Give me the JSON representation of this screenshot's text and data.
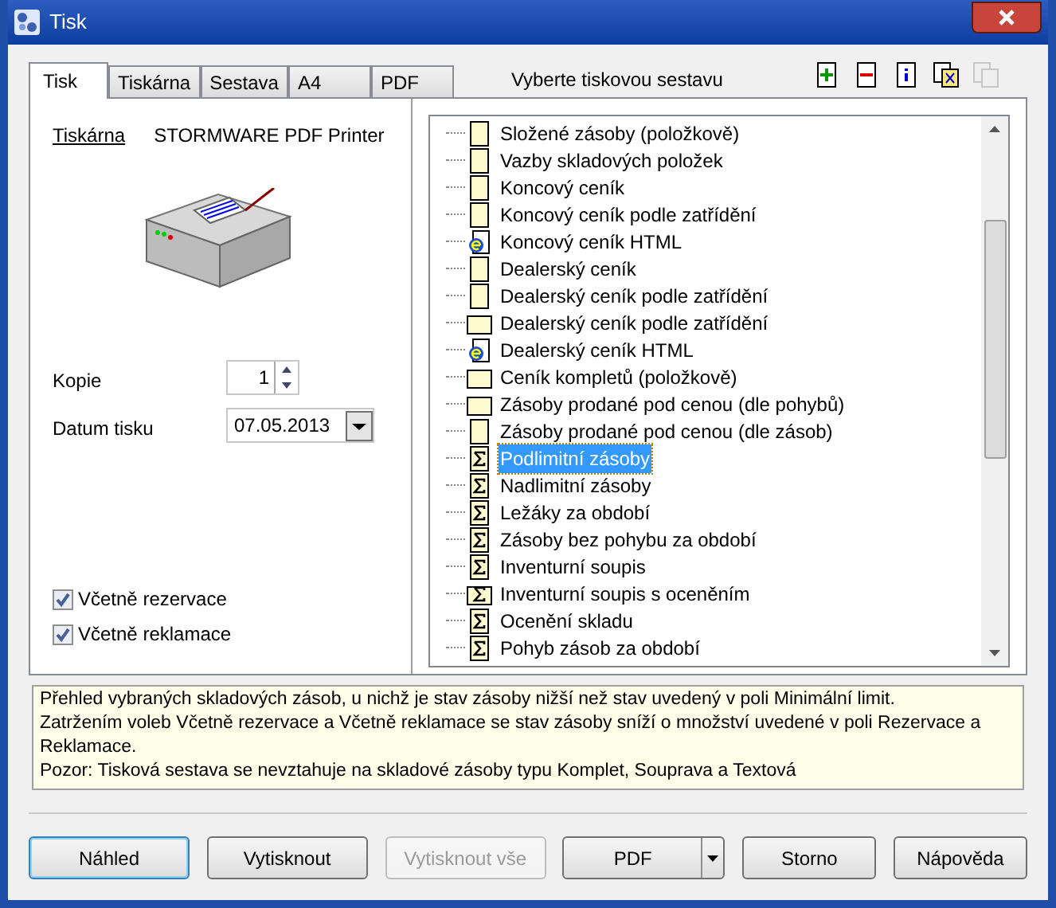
{
  "window": {
    "title": "Tisk"
  },
  "tabs": [
    {
      "label": "Tisk",
      "selected": true
    },
    {
      "label": "Tiskárna",
      "selected": false
    },
    {
      "label": "Sestava",
      "selected": false
    },
    {
      "label": "A4",
      "selected": false
    },
    {
      "label": "PDF",
      "selected": false
    }
  ],
  "report_heading": "Vyberte tiskovou sestavu",
  "printer": {
    "label": "Tiskárna",
    "name": "STORMWARE PDF Printer"
  },
  "copies": {
    "label": "Kopie",
    "value": "1"
  },
  "print_date": {
    "label": "Datum tisku",
    "value": "07.05.2013"
  },
  "options": [
    {
      "label": "Včetně rezervace",
      "checked": true
    },
    {
      "label": "Včetně reklamace",
      "checked": true
    }
  ],
  "reports": [
    {
      "label": "Složené zásoby (položkově)",
      "kind": "page",
      "selected": false
    },
    {
      "label": "Vazby skladových položek",
      "kind": "page",
      "selected": false
    },
    {
      "label": "Koncový ceník",
      "kind": "page",
      "selected": false
    },
    {
      "label": "Koncový ceník podle zatřídění",
      "kind": "page",
      "selected": false
    },
    {
      "label": "Koncový ceník HTML",
      "kind": "web",
      "selected": false
    },
    {
      "label": "Dealerský ceník",
      "kind": "page",
      "selected": false
    },
    {
      "label": "Dealerský ceník podle zatřídění",
      "kind": "page",
      "selected": false
    },
    {
      "label": "Dealerský ceník podle zatřídění",
      "kind": "wide",
      "selected": false
    },
    {
      "label": "Dealerský ceník HTML",
      "kind": "web",
      "selected": false
    },
    {
      "label": "Ceník kompletů (položkově)",
      "kind": "wide",
      "selected": false
    },
    {
      "label": "Zásoby prodané pod cenou (dle pohybů)",
      "kind": "wide",
      "selected": false
    },
    {
      "label": "Zásoby prodané pod cenou (dle zásob)",
      "kind": "page",
      "selected": false
    },
    {
      "label": "Podlimitní zásoby",
      "kind": "sum",
      "selected": true
    },
    {
      "label": "Nadlimitní zásoby",
      "kind": "sum",
      "selected": false
    },
    {
      "label": "Ležáky za období",
      "kind": "sum",
      "selected": false
    },
    {
      "label": "Zásoby bez pohybu za období",
      "kind": "sum",
      "selected": false
    },
    {
      "label": "Inventurní soupis",
      "kind": "sum",
      "selected": false
    },
    {
      "label": "Inventurní soupis s oceněním",
      "kind": "sumwide",
      "selected": false
    },
    {
      "label": "Ocenění skladu",
      "kind": "sum",
      "selected": false
    },
    {
      "label": "Pohyb zásob za období",
      "kind": "sum",
      "selected": false
    }
  ],
  "description": [
    "Přehled vybraných skladových zásob, u nichž je stav zásoby nižší než stav uvedený v poli Minimální limit.",
    "Zatržením voleb Včetně rezervace a Včetně reklamace se stav zásoby sníží o množství uvedené v poli Rezervace a Reklamace.",
    "Pozor: Tisková sestava se nevztahuje na skladové zásoby typu Komplet, Souprava a Textová"
  ],
  "buttons": [
    {
      "label": "Náhled",
      "kind": "default",
      "disabled": false
    },
    {
      "label": "Vytisknout",
      "kind": "plain",
      "disabled": false
    },
    {
      "label": "Vytisknout vše",
      "kind": "plain",
      "disabled": true
    },
    {
      "label": "PDF",
      "kind": "split",
      "disabled": false
    },
    {
      "label": "Storno",
      "kind": "plain",
      "disabled": false
    },
    {
      "label": "Nápověda",
      "kind": "plain",
      "disabled": false
    }
  ]
}
